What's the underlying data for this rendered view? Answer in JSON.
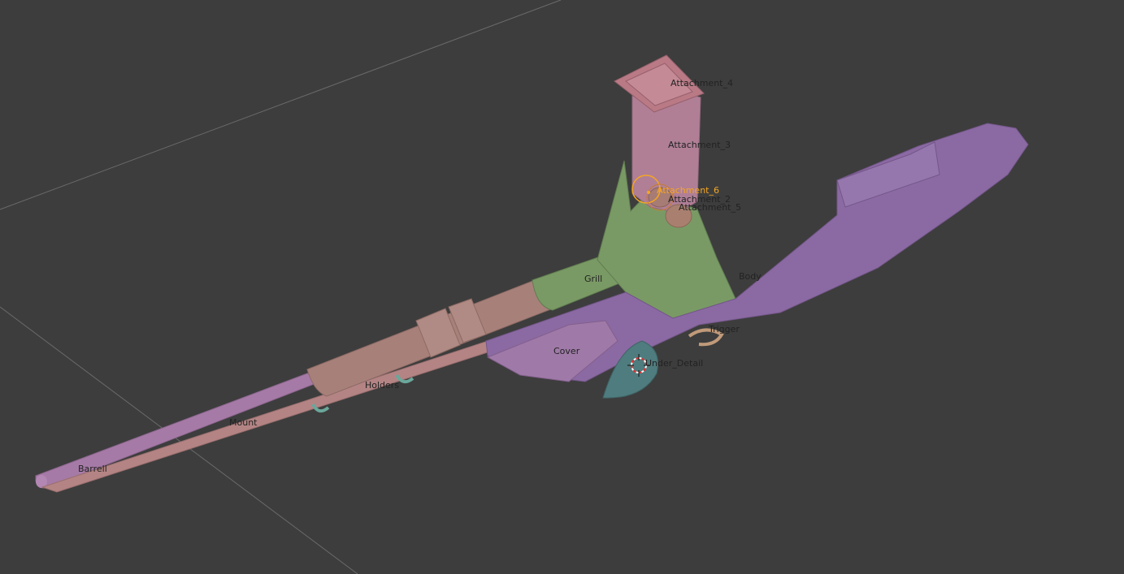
{
  "viewport": {
    "background": "#3d3d3d",
    "grid_color": "#6a6a6a",
    "active_color": "#f5a623"
  },
  "objects": [
    {
      "name": "Attachment_4",
      "color": "#b97a86",
      "active": false
    },
    {
      "name": "Attachment_3",
      "color": "#b07f96",
      "active": false
    },
    {
      "name": "Attachment_6",
      "color": "#c77a5a",
      "active": true
    },
    {
      "name": "Attachment_2",
      "color": "#a67c74",
      "active": false
    },
    {
      "name": "Attachment_5",
      "color": "#a98070",
      "active": false
    },
    {
      "name": "Grill",
      "color": "#7a9a65",
      "active": false
    },
    {
      "name": "Body",
      "color": "#8b6aa3",
      "active": false
    },
    {
      "name": "Trigger",
      "color": "#c09a7a",
      "active": false
    },
    {
      "name": "Cover",
      "color": "#9f7aa8",
      "active": false
    },
    {
      "name": "Under_Detail",
      "color": "#4f7c7e",
      "active": false
    },
    {
      "name": "Holders",
      "color": "#6aa79a",
      "active": false
    },
    {
      "name": "Mount",
      "color": "#b48484",
      "active": false
    },
    {
      "name": "Barrell",
      "color": "#a67aa6",
      "active": false
    }
  ],
  "cursor_icon": "3d-cursor-icon"
}
